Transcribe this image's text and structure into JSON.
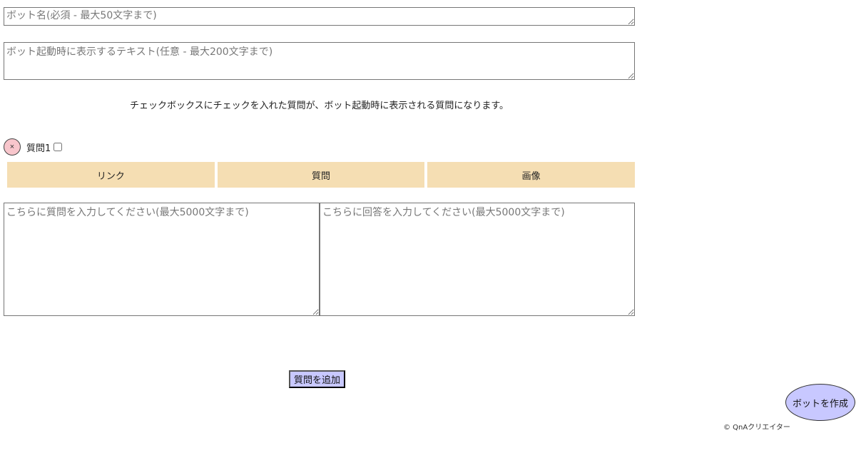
{
  "form": {
    "bot_name_placeholder": "ボット名(必須 - 最大50文字まで)",
    "bot_intro_placeholder": "ボット起動時に表示するテキスト(任意 - 最大200文字まで)",
    "notice": "チェックボックスにチェックを入れた質問が、ボット起動時に表示される質問になります。"
  },
  "question": {
    "remove_label": "×",
    "label": "質問1",
    "checked": false,
    "tabs": [
      "リンク",
      "質問",
      "画像"
    ],
    "question_placeholder": "こちらに質問を入力してください(最大5000文字まで)",
    "answer_placeholder": "こちらに回答を入力してください(最大5000文字まで)"
  },
  "actions": {
    "add_question": "質問を追加",
    "create_bot": "ボットを作成"
  },
  "footer": {
    "copyright": "© QnAクリエイター"
  },
  "colors": {
    "tab_bg": "#f5deb3",
    "button_bg": "#c8c8ff",
    "remove_bg": "#f8c6cc"
  }
}
